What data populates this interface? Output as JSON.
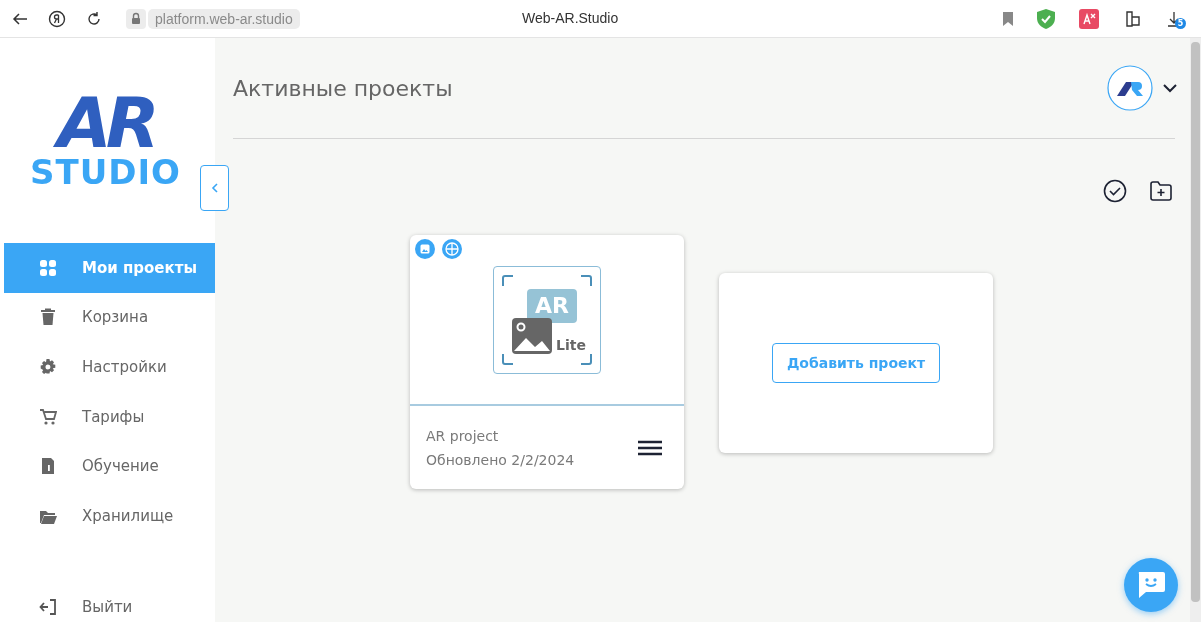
{
  "browser": {
    "url": "platform.web-ar.studio",
    "title": "Web-AR.Studio",
    "downloads_badge": "5"
  },
  "logo": {
    "mark": "AR",
    "word": "STUDIO"
  },
  "sidebar": {
    "items": [
      {
        "label": "Мои проекты",
        "selected": true
      },
      {
        "label": "Корзина",
        "selected": false
      },
      {
        "label": "Настройки",
        "selected": false
      },
      {
        "label": "Тарифы",
        "selected": false
      },
      {
        "label": "Обучение",
        "selected": false
      },
      {
        "label": "Хранилище",
        "selected": false
      }
    ],
    "logout": "Выйти"
  },
  "header": {
    "title": "Активные проекты"
  },
  "projects": [
    {
      "name": "AR project",
      "updated": "Обновлено 2/2/2024",
      "thumb_mark": "AR",
      "thumb_tag": "Lite"
    }
  ],
  "add_project": "Добавить проект"
}
